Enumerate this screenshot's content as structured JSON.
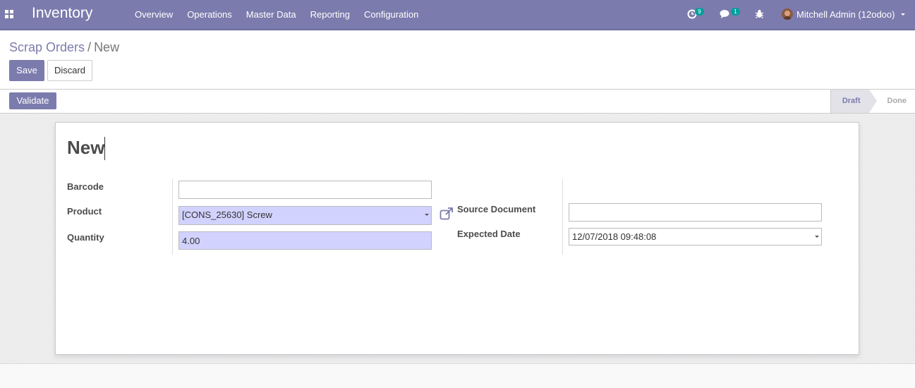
{
  "navbar": {
    "app_name": "Inventory",
    "menu": [
      "Overview",
      "Operations",
      "Master Data",
      "Reporting",
      "Configuration"
    ],
    "activities_count": "9",
    "messages_count": "1",
    "user_name": "Mitchell Admin (12odoo)",
    "colors": {
      "bar": "#7c7bad",
      "badge": "#00a09d"
    }
  },
  "control_panel": {
    "breadcrumb_parent": "Scrap Orders",
    "breadcrumb_separator": "/",
    "breadcrumb_current": "New",
    "save_label": "Save",
    "discard_label": "Discard"
  },
  "statusbar": {
    "validate_label": "Validate",
    "states": [
      {
        "label": "Draft",
        "active": true
      },
      {
        "label": "Done",
        "active": false
      }
    ]
  },
  "form": {
    "title": "New",
    "barcode_label": "Barcode",
    "barcode_value": "",
    "product_label": "Product",
    "product_value": "[CONS_25630] Screw",
    "quantity_label": "Quantity",
    "quantity_value": "4.00",
    "source_document_label": "Source Document",
    "source_document_value": "",
    "expected_date_label": "Expected Date",
    "expected_date_value": "12/07/2018 09:48:08"
  }
}
